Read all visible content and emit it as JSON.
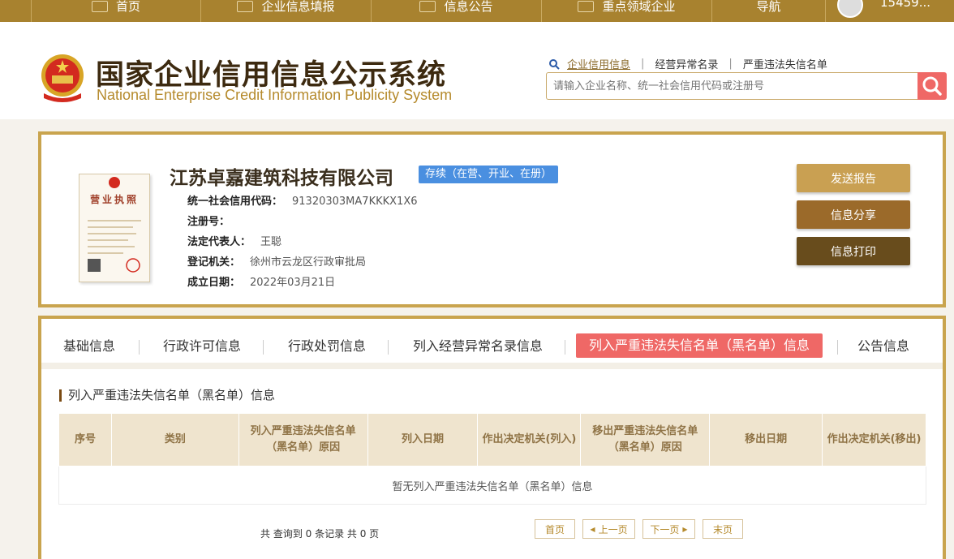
{
  "topnav": {
    "items": [
      {
        "label": "首页",
        "icon": "home-icon"
      },
      {
        "label": "企业信息填报",
        "icon": "edit-icon"
      },
      {
        "label": "信息公告",
        "icon": "notice-icon"
      },
      {
        "label": "重点领域企业",
        "icon": "megaphone-icon"
      },
      {
        "label": "导航",
        "icon": ""
      }
    ],
    "user": "15459..."
  },
  "header": {
    "title_cn": "国家企业信用信息公示系统",
    "title_en": "National Enterprise Credit Information Publicity System",
    "links": [
      "企业信用信息",
      "经营异常名录",
      "严重违法失信名单"
    ],
    "search_placeholder": "请输入企业名称、统一社会信用代码或注册号"
  },
  "company": {
    "name": "江苏卓嘉建筑科技有限公司",
    "status": "存续（在营、开业、在册）",
    "fields": [
      {
        "label": "统一社会信用代码：",
        "value": "91320303MA7KKKX1X6"
      },
      {
        "label": "注册号：",
        "value": ""
      },
      {
        "label": "法定代表人：",
        "value": "王聪"
      },
      {
        "label": "登记机关：",
        "value": "徐州市云龙区行政审批局"
      },
      {
        "label": "成立日期：",
        "value": "2022年03月21日"
      }
    ],
    "license_title": "营业执照"
  },
  "actions": {
    "send_report": "发送报告",
    "share": "信息分享",
    "print": "信息打印"
  },
  "colors": {
    "gold": "#a8822f",
    "border": "#c9a44e",
    "red": "#ef6866",
    "blue": "#4a8fe0"
  },
  "tabs": [
    "基础信息",
    "行政许可信息",
    "行政处罚信息",
    "列入经营异常名录信息",
    "列入严重违法失信名单（黑名单）信息",
    "公告信息"
  ],
  "section": {
    "title": "列入严重违法失信名单（黑名单）信息",
    "columns": [
      "序号",
      "类别",
      "列入严重违法失信名单（黑名单）原因",
      "列入日期",
      "作出决定机关(列入)",
      "移出严重违法失信名单（黑名单）原因",
      "移出日期",
      "作出决定机关(移出)"
    ],
    "empty_text": "暂无列入严重违法失信名单（黑名单）信息"
  },
  "pagination": {
    "info": "共 查询到 0 条记录 共 0 页",
    "first": "首页",
    "prev": "上一页",
    "next": "下一页",
    "last": "末页"
  }
}
